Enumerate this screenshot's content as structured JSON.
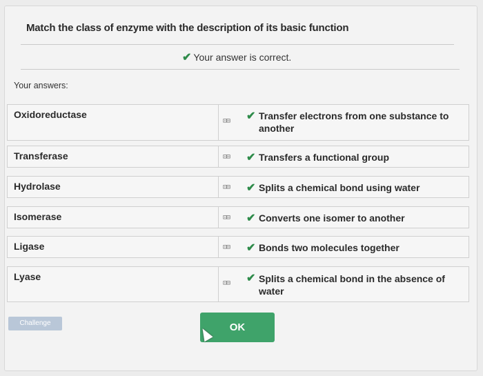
{
  "question": {
    "title": "Match the class of enzyme with the description of its basic function",
    "correct_text": "Your answer is correct.",
    "answers_label": "Your answers:"
  },
  "link_icon_text": "⊡⊟",
  "matches": [
    {
      "term": "Oxidoreductase",
      "description": "Transfer electrons from one substance to another"
    },
    {
      "term": "Transferase",
      "description": "Transfers a functional group"
    },
    {
      "term": "Hydrolase",
      "description": "Splits a chemical bond using water"
    },
    {
      "term": "Isomerase",
      "description": "Converts one isomer to another"
    },
    {
      "term": "Ligase",
      "description": "Bonds two molecules together"
    },
    {
      "term": "Lyase",
      "description": "Splits a chemical bond in the absence of water"
    }
  ],
  "buttons": {
    "challenge": "Challenge",
    "ok": "OK"
  },
  "colors": {
    "correct": "#2e8b4a",
    "ok_button": "#3fa36a",
    "challenge_button": "#b9c7d8"
  },
  "icons": {
    "correct": "check-icon",
    "link": "link-connector-icon",
    "pointer": "mouse-pointer-icon"
  }
}
